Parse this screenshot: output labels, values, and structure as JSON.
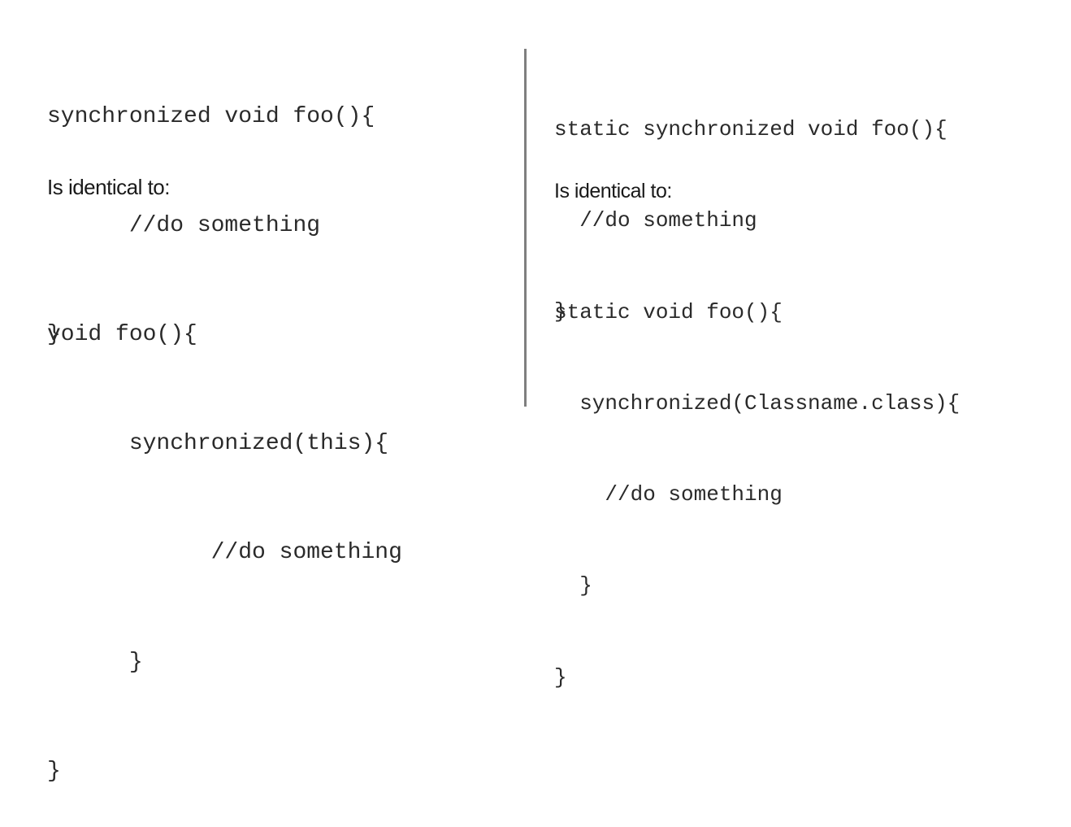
{
  "left": {
    "block1": [
      "synchronized void foo(){",
      "      //do something",
      "}"
    ],
    "note": "Is identical to:",
    "block2": [
      "void foo(){",
      "      synchronized(this){",
      "            //do something",
      "      }",
      "}"
    ]
  },
  "right": {
    "block1": [
      "static synchronized void foo(){",
      "  //do something",
      "}"
    ],
    "note": "Is identical to:",
    "block2": [
      "static void foo(){",
      "  synchronized(Classname.class){",
      "    //do something",
      "  }",
      "}"
    ]
  },
  "colors": {
    "divider": "#7f7f7f",
    "text": "#2a2a2a"
  }
}
